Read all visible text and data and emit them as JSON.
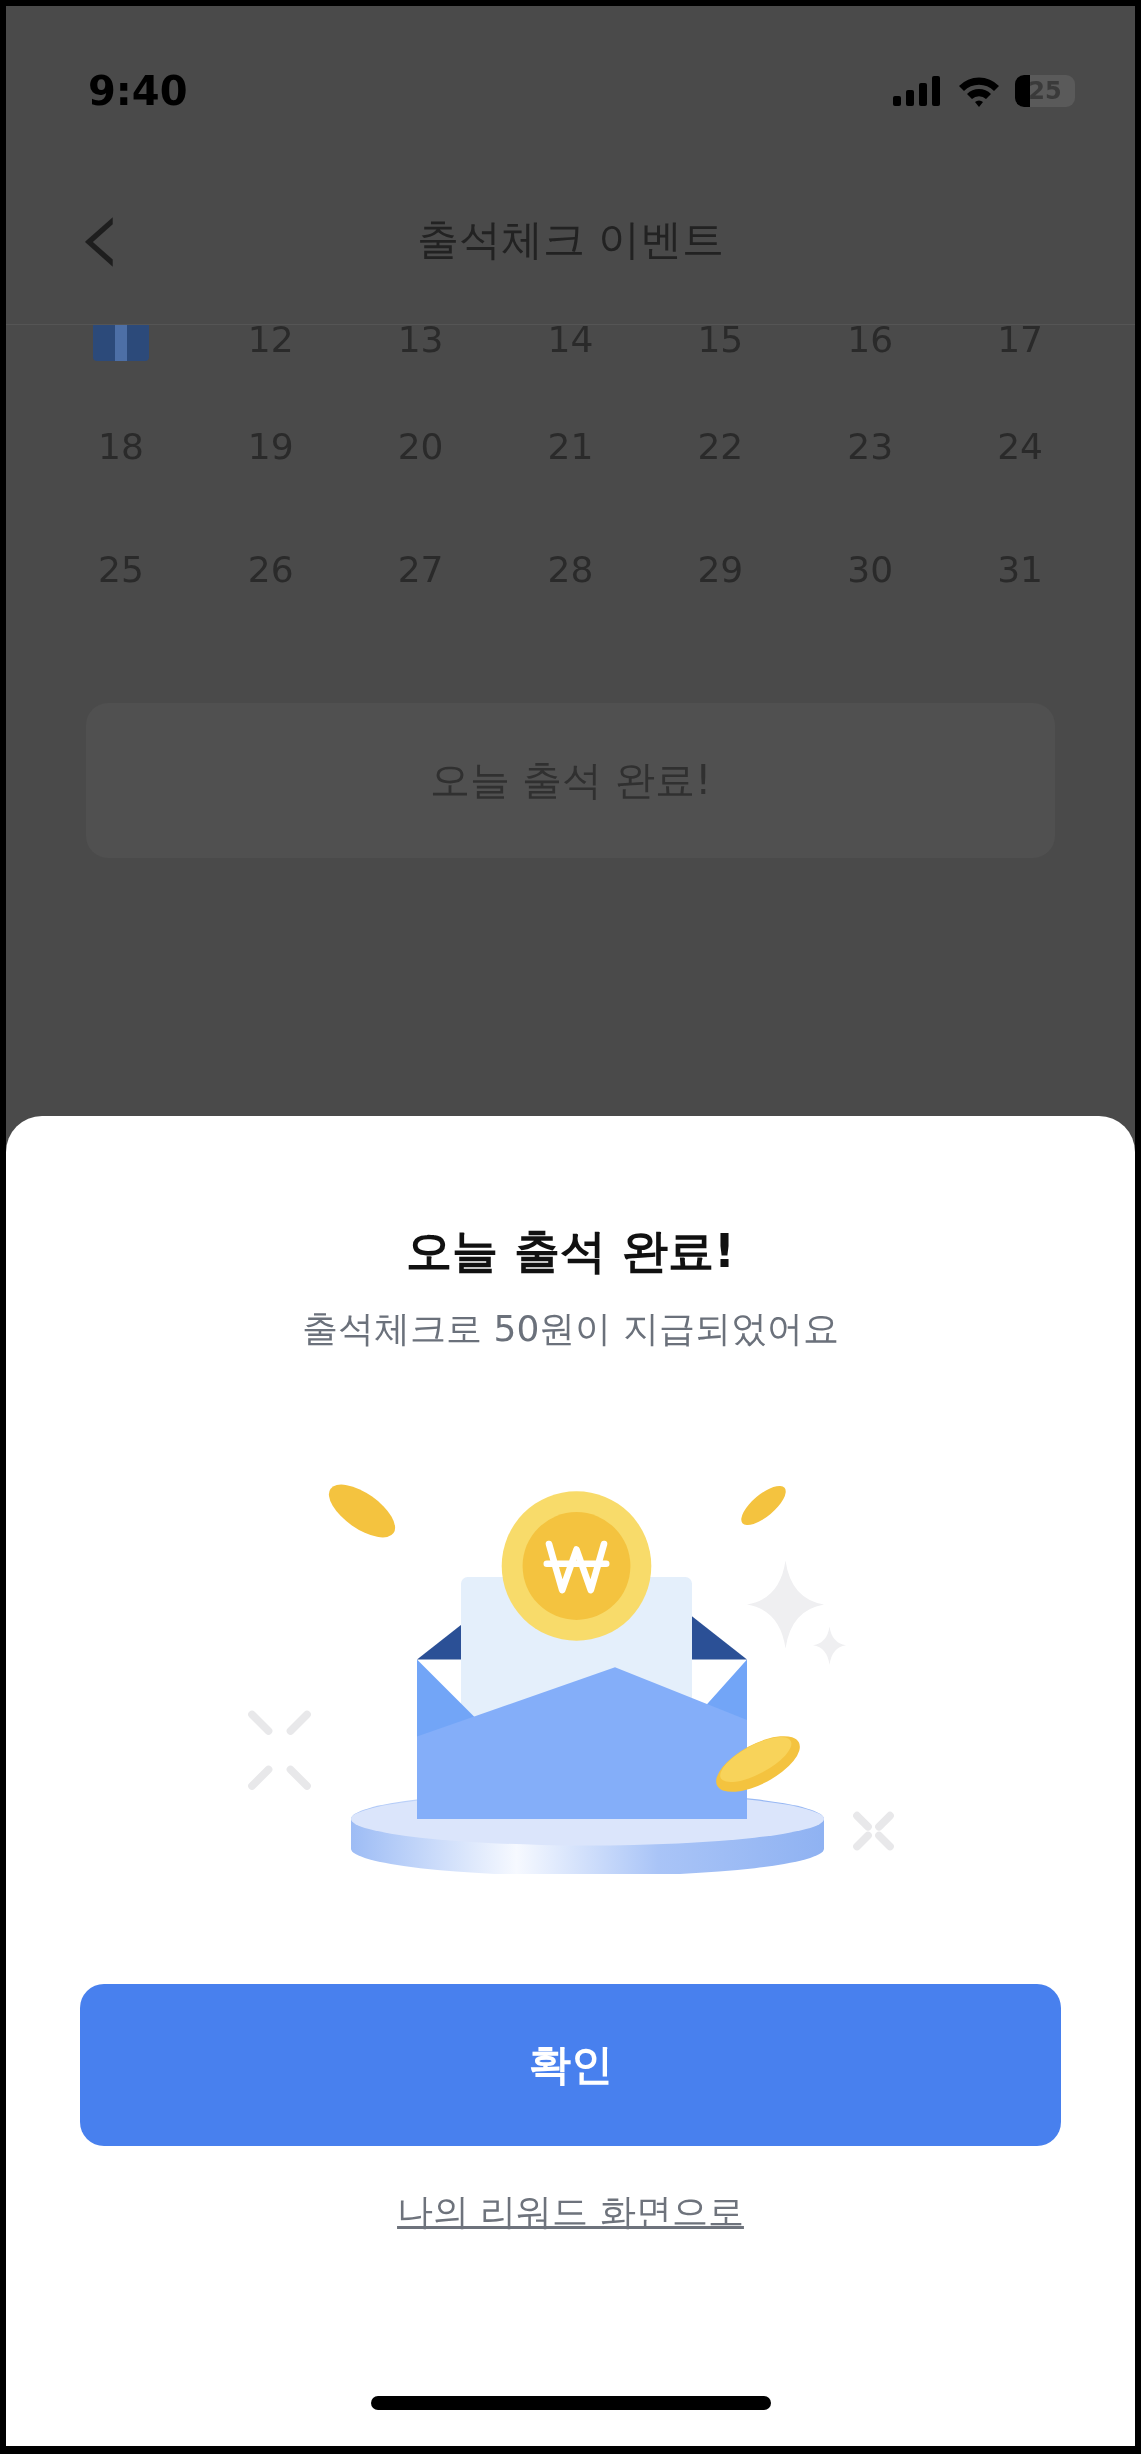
{
  "status_bar": {
    "time": "9:40",
    "battery": "25"
  },
  "header": {
    "back": "‹",
    "title": "출석체크 이벤트"
  },
  "calendar": {
    "rows": [
      [
        {
          "kind": "gift"
        },
        {
          "kind": "day",
          "label": "12"
        },
        {
          "kind": "day",
          "label": "13"
        },
        {
          "kind": "day",
          "label": "14"
        },
        {
          "kind": "day",
          "label": "15"
        },
        {
          "kind": "day",
          "label": "16"
        },
        {
          "kind": "day",
          "label": "17"
        }
      ],
      [
        {
          "kind": "day",
          "label": "18"
        },
        {
          "kind": "day",
          "label": "19"
        },
        {
          "kind": "day",
          "label": "20"
        },
        {
          "kind": "day",
          "label": "21"
        },
        {
          "kind": "day",
          "label": "22"
        },
        {
          "kind": "day",
          "label": "23"
        },
        {
          "kind": "day",
          "label": "24"
        }
      ],
      [
        {
          "kind": "day",
          "label": "25"
        },
        {
          "kind": "day",
          "label": "26"
        },
        {
          "kind": "day",
          "label": "27"
        },
        {
          "kind": "day",
          "label": "28"
        },
        {
          "kind": "day",
          "label": "29"
        },
        {
          "kind": "day",
          "label": "30"
        },
        {
          "kind": "day",
          "label": "31"
        }
      ]
    ]
  },
  "attend_button": {
    "label": "오늘 출석 완료!",
    "disabled": true
  },
  "sheet": {
    "title": "오늘 출석 완료!",
    "subtitle": "출석체크로 50원이 지급되었어요",
    "confirm": "확인",
    "link": "나의 리워드 화면으로"
  }
}
